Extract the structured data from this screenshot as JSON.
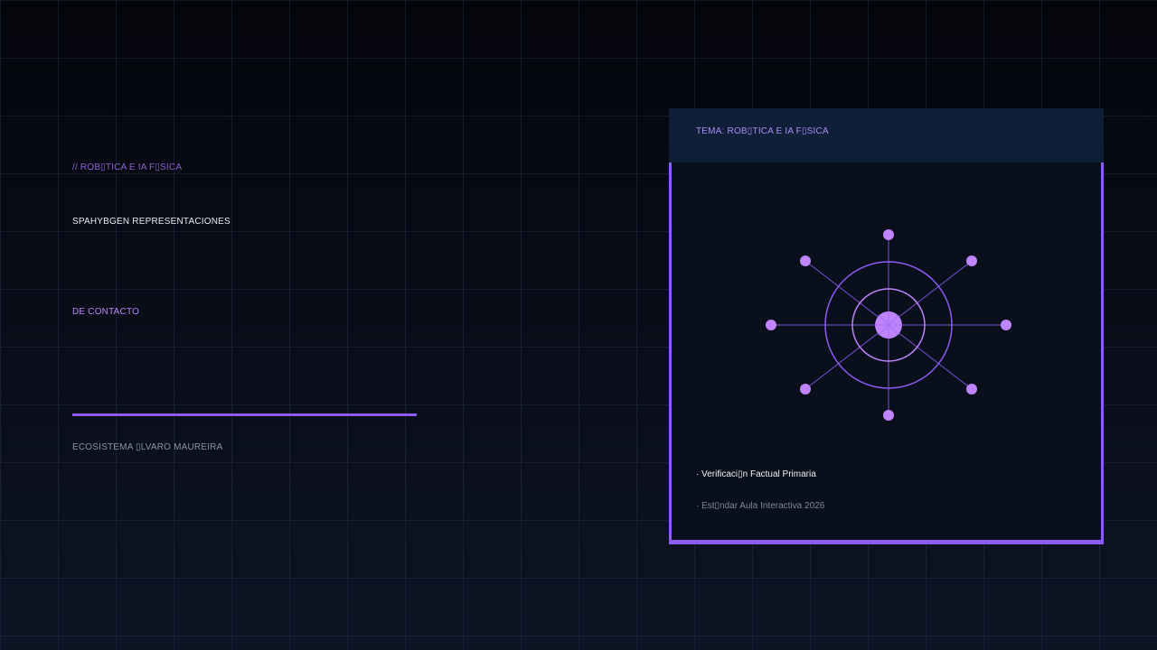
{
  "slide": {
    "kicker": "// ROB▯TICA E IA F▯SICA",
    "headline": "SPAHYBGEN REPRESENTACIONES",
    "contact_label": "DE CONTACTO",
    "footer_name": "ECOSISTEMA ▯LVARO MAUREIRA"
  },
  "card": {
    "topic": "TEMA: ROB▯TICA E IA F▯SICA",
    "bullets": [
      "· Verificaci▯n Factual Primaria",
      "· Est▯ndar Aula Interactiva 2026"
    ],
    "diagram_icon": "network-hub-icon"
  },
  "colors": {
    "accent": "#8d5cf6",
    "accent_light": "#c084fc",
    "header_bg": "#0f1f38",
    "card_bg": "#0a0f1c",
    "background": "#05060c"
  }
}
